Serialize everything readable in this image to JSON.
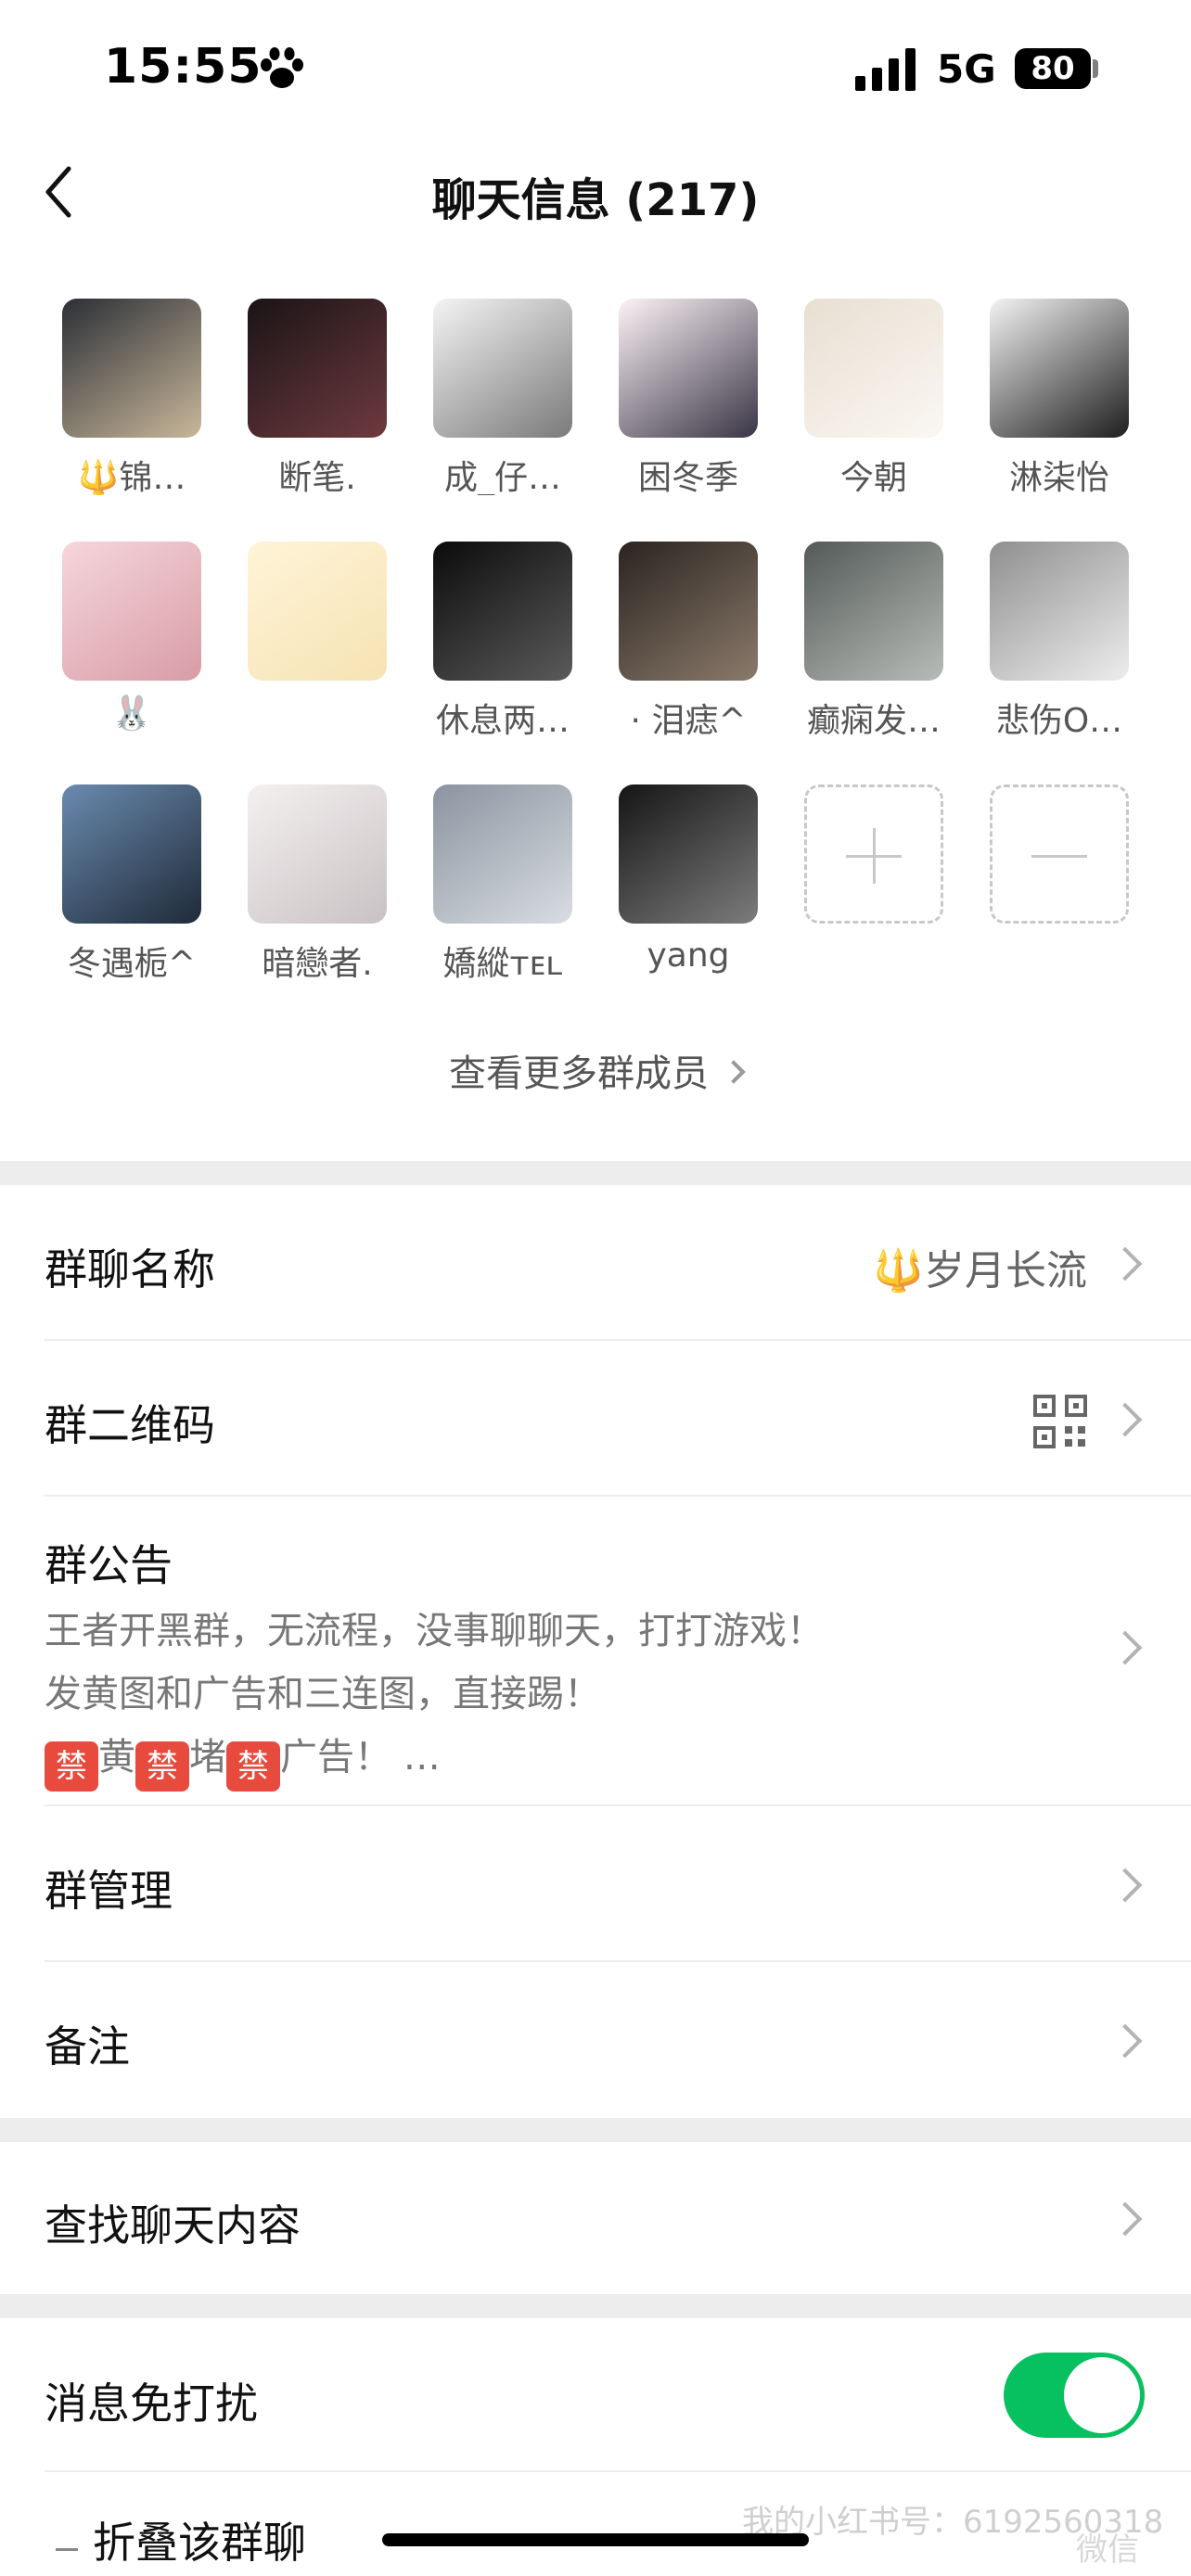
{
  "status_bar": {
    "time": "15:55",
    "network": "5G",
    "battery": "80"
  },
  "nav": {
    "title": "聊天信息 (217)"
  },
  "members": [
    {
      "name": "🔱锦…",
      "colors": [
        "#2b2f36",
        "#c9b79a"
      ]
    },
    {
      "name": "断笔.",
      "colors": [
        "#1a1416",
        "#6e3a3f"
      ]
    },
    {
      "name": "成_仔…",
      "colors": [
        "#f4f4f4",
        "#7a7a7a"
      ]
    },
    {
      "name": "困冬季",
      "colors": [
        "#fbf3f6",
        "#3a3545"
      ]
    },
    {
      "name": "今朝",
      "colors": [
        "#e8dfd2",
        "#faf7f2"
      ]
    },
    {
      "name": "淋柒怡",
      "colors": [
        "#f3f3f3",
        "#1e1e1e"
      ]
    },
    {
      "name": "🐰",
      "colors": [
        "#f6d6dc",
        "#d89ca6"
      ]
    },
    {
      "name": "",
      "colors": [
        "#fff4d8",
        "#f6e3b3"
      ]
    },
    {
      "name": "休息两…",
      "colors": [
        "#0b0b0b",
        "#5a5a5a"
      ]
    },
    {
      "name": "· 泪痣^",
      "colors": [
        "#2a2420",
        "#8b7a6b"
      ]
    },
    {
      "name": "癫痫发…",
      "colors": [
        "#545a58",
        "#b8bcb8"
      ]
    },
    {
      "name": "悲伤O…",
      "colors": [
        "#8f8f8f",
        "#ededed"
      ]
    },
    {
      "name": "冬遇栀^",
      "colors": [
        "#6a8bb0",
        "#1f2a38"
      ]
    },
    {
      "name": "暗戀者.",
      "colors": [
        "#f4f0f0",
        "#c9c2c4"
      ]
    },
    {
      "name": "嬌縱ᴛᴇʟ",
      "colors": [
        "#8a94a0",
        "#d9dde2"
      ]
    },
    {
      "name": "yang",
      "colors": [
        "#151515",
        "#7c7c7c"
      ]
    }
  ],
  "more_members": "查看更多群成员",
  "settings": {
    "group_name_label": "群聊名称",
    "group_name_value": "🔱岁月长流",
    "qr_label": "群二维码",
    "notice_label": "群公告",
    "notice_line1": "王者开黑群，无流程，没事聊聊天，打打游戏！",
    "notice_line2": "发黄图和广告和三连图，直接踢！",
    "notice_ban": "禁",
    "notice_w1": "黄",
    "notice_w2": "堵",
    "notice_w3": "广告！ …",
    "manage_label": "群管理",
    "remark_label": "备注",
    "search_label": "查找聊天内容",
    "mute_label": "消息免打扰",
    "mute_on": true,
    "fold_label": "折叠该群聊"
  },
  "watermark": "我的小红书号：6192560318",
  "watermark_2": "微信",
  "colors": {
    "toggle": "#07c160",
    "ban": "#e84b3d",
    "section_gap": "#ededed"
  }
}
